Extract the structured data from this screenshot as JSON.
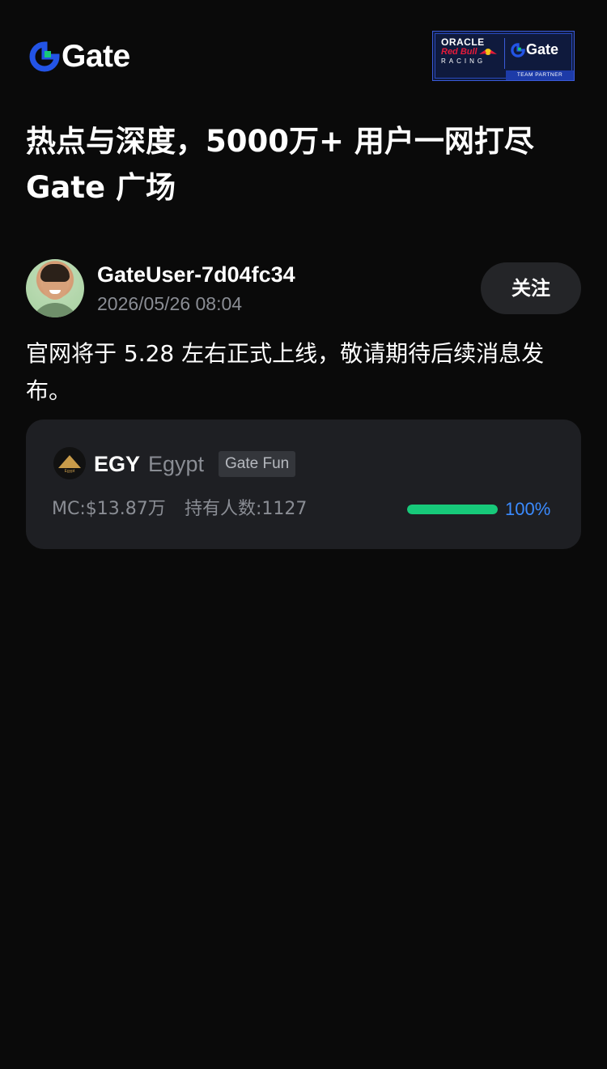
{
  "header": {
    "logo_text": "Gate",
    "partner_badge": {
      "line1": "ORACLE",
      "line2": "Red Bull",
      "line3": "RACING",
      "brand": "Gate",
      "tag": "TEAM PARTNER"
    }
  },
  "headline": {
    "line1": "热点与深度，5000万+ 用户一网打尽",
    "line2": "Gate 广场"
  },
  "post": {
    "username": "GateUser-7d04fc34",
    "time": "2026/05/26 08:04",
    "follow_label": "关注",
    "body": "官网将于 5.28 左右正式上线，敬请期待后续消息发布。"
  },
  "token": {
    "icon_label": "Egypt",
    "symbol": "EGY",
    "name": "Egypt",
    "tag": "Gate Fun",
    "mc": "MC:$13.87万",
    "holders": "持有人数:1127",
    "progress_value": 1.0,
    "progress_label": "100%"
  },
  "colors": {
    "background": "#0a0a0a",
    "brand_blue": "#2354e6",
    "brand_green": "#17c97a",
    "progress_text": "#3b8bff",
    "card": "#1e1f23"
  }
}
